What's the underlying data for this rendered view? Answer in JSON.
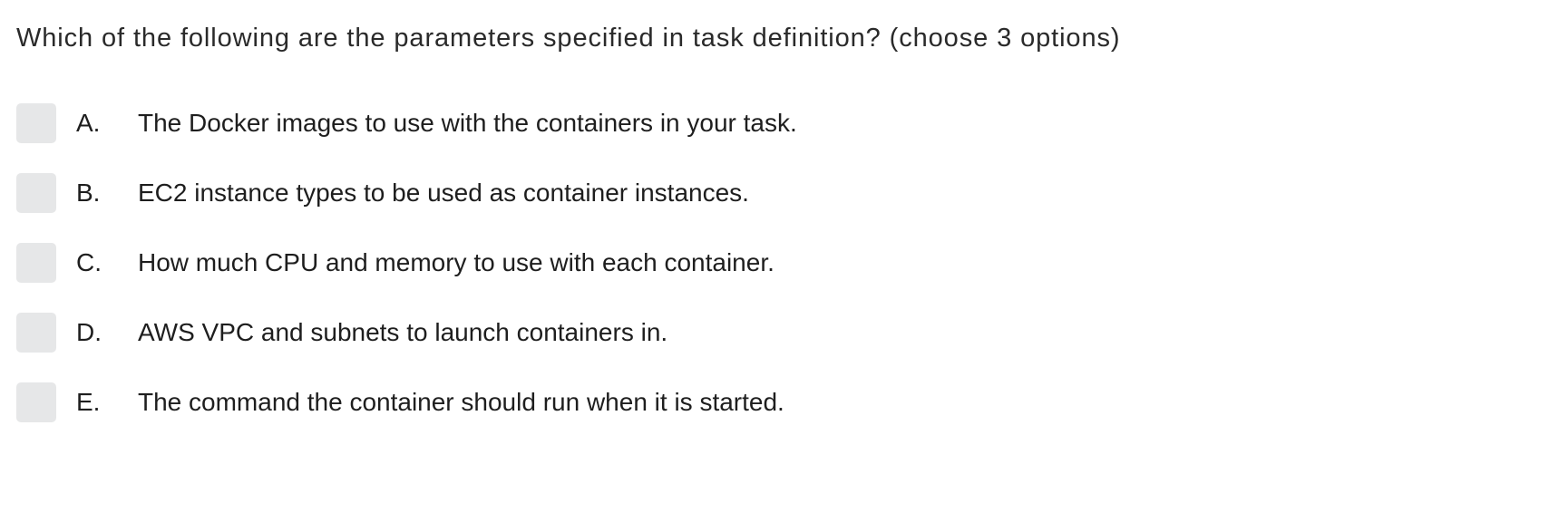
{
  "question": {
    "text": "Which of the following are the parameters specified in task definition? (choose 3 options)"
  },
  "options": [
    {
      "letter": "A.",
      "text": "The Docker images to use with the containers in your task.",
      "checked": false
    },
    {
      "letter": "B.",
      "text": "EC2 instance types to be used as container instances.",
      "checked": false
    },
    {
      "letter": "C.",
      "text": "How much CPU and memory to use with each container.",
      "checked": false
    },
    {
      "letter": "D.",
      "text": "AWS VPC and subnets to launch containers in.",
      "checked": false
    },
    {
      "letter": "E.",
      "text": "The command the container should run when it is started.",
      "checked": false
    }
  ],
  "colors": {
    "checkbox_fill": "#e6e7e8",
    "text": "#1e1e1e"
  }
}
